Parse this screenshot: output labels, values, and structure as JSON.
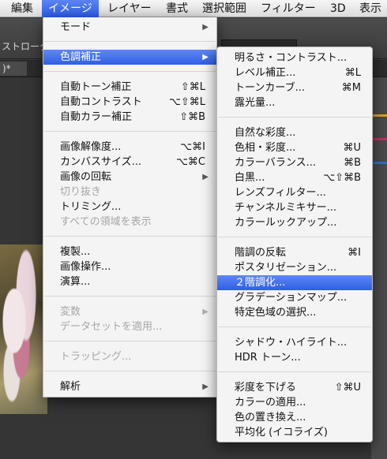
{
  "menubar": {
    "items": [
      "編集",
      "イメージ",
      "レイヤー",
      "書式",
      "選択範囲",
      "フィルター",
      "3D",
      "表示"
    ]
  },
  "background": {
    "stroke_label": "ストローク",
    "doc_tab": ")*"
  },
  "image_menu": {
    "mode": "モード",
    "adjustments": "色調補正",
    "auto_tone": {
      "label": "自動トーン補正",
      "shortcut": "⇧⌘L"
    },
    "auto_contrast": {
      "label": "自動コントラスト",
      "shortcut": "⌥⇧⌘L"
    },
    "auto_color": {
      "label": "自動カラー補正",
      "shortcut": "⇧⌘B"
    },
    "image_size": {
      "label": "画像解像度...",
      "shortcut": "⌥⌘I"
    },
    "canvas_size": {
      "label": "カンバスサイズ...",
      "shortcut": "⌥⌘C"
    },
    "image_rotation": "画像の回転",
    "crop": "切り抜き",
    "trim": "トリミング...",
    "reveal_all": "すべての領域を表示",
    "duplicate": "複製...",
    "apply_image": "画像操作...",
    "calculations": "演算...",
    "variables": "変数",
    "apply_data_set": "データセットを適用...",
    "trap": "トラッピング...",
    "analysis": "解析"
  },
  "adjustments_menu": {
    "brightness_contrast": "明るさ・コントラスト...",
    "levels": {
      "label": "レベル補正...",
      "shortcut": "⌘L"
    },
    "curves": {
      "label": "トーンカーブ...",
      "shortcut": "⌘M"
    },
    "exposure": "露光量...",
    "vibrance": "自然な彩度...",
    "hue_saturation": {
      "label": "色相・彩度...",
      "shortcut": "⌘U"
    },
    "color_balance": {
      "label": "カラーバランス...",
      "shortcut": "⌘B"
    },
    "black_white": {
      "label": "白黒...",
      "shortcut": "⌥⇧⌘B"
    },
    "photo_filter": "レンズフィルター...",
    "channel_mixer": "チャンネルミキサー...",
    "color_lookup": "カラールックアップ...",
    "invert": {
      "label": "階調の反転",
      "shortcut": "⌘I"
    },
    "posterize": "ポスタリゼーション...",
    "threshold": "２階調化...",
    "gradient_map": "グラデーションマップ...",
    "selective_color": "特定色域の選択...",
    "shadows_highlights": "シャドウ・ハイライト...",
    "hdr_toning": "HDR トーン...",
    "desaturate": {
      "label": "彩度を下げる",
      "shortcut": "⇧⌘U"
    },
    "match_color": "カラーの適用...",
    "replace_color": "色の置き換え...",
    "equalize": "平均化 (イコライズ)"
  }
}
